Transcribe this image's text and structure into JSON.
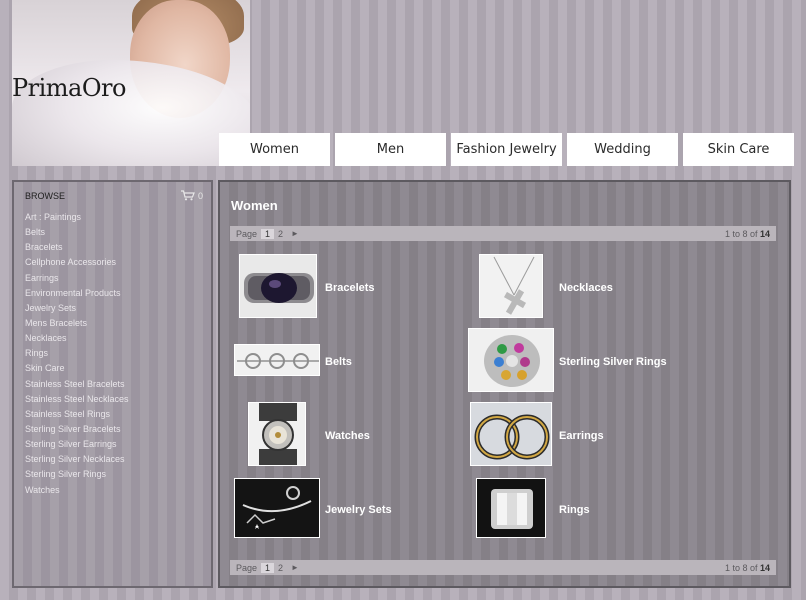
{
  "header": {
    "logo": "PrimaOro",
    "nav": [
      "Women",
      "Men",
      "Fashion Jewelry",
      "Wedding",
      "Skin Care"
    ]
  },
  "sidebar": {
    "title": "BROWSE",
    "cart_count": "0",
    "categories": [
      "Art : Paintings",
      "Belts",
      "Bracelets",
      "Cellphone Accessories",
      "Earrings",
      "Environmental Products",
      "Jewelry Sets",
      "Mens Bracelets",
      "Necklaces",
      "Rings",
      "Skin Care",
      "Stainless Steel Bracelets",
      "Stainless Steel Necklaces",
      "Stainless Steel Rings",
      "Sterling Silver Bracelets",
      "Sterling Silver Earrings",
      "Sterling Silver Necklaces",
      "Sterling Silver Rings",
      "Watches"
    ]
  },
  "main": {
    "title": "Women",
    "pager": {
      "page_label": "Page",
      "pages": [
        "1",
        "2"
      ],
      "current": "1",
      "next_arrow": "►",
      "range_text": "1 to 8 of",
      "total": "14"
    },
    "products": [
      {
        "name": "Bracelets"
      },
      {
        "name": "Necklaces"
      },
      {
        "name": "Belts"
      },
      {
        "name": "Sterling Silver Rings"
      },
      {
        "name": "Watches"
      },
      {
        "name": "Earrings"
      },
      {
        "name": "Jewelry Sets"
      },
      {
        "name": "Rings"
      }
    ]
  },
  "icons": {
    "cart": "shopping-cart-icon",
    "next": "arrow-right-icon"
  }
}
